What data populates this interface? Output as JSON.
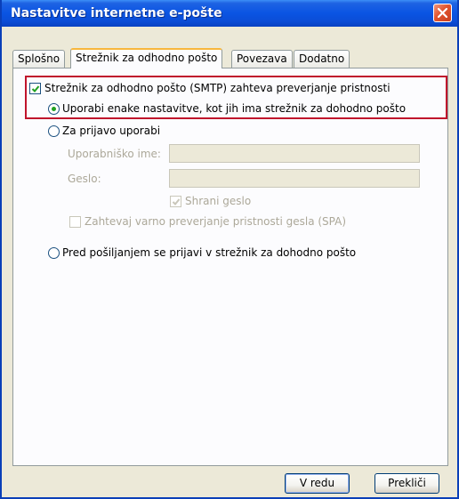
{
  "window": {
    "title": "Nastavitve internetne e-pošte"
  },
  "tabs": [
    {
      "label": "Splošno"
    },
    {
      "label": "Strežnik za odhodno pošto"
    },
    {
      "label": "Povezava"
    },
    {
      "label": "Dodatno"
    }
  ],
  "smtp": {
    "require_auth_label": "Strežnik za odhodno pošto (SMTP) zahteva preverjanje pristnosti",
    "require_auth_checked": true,
    "option_same_label": "Uporabi enake nastavitve, kot jih ima strežnik za dohodno pošto",
    "option_same_selected": true,
    "option_login_label": "Za prijavo uporabi",
    "username_label": "Uporabniško ime:",
    "username_value": "",
    "password_label": "Geslo:",
    "password_value": "",
    "save_password_label": "Shrani geslo",
    "save_password_checked": true,
    "spa_label": "Zahtevaj varno preverjanje pristnosti gesla (SPA)",
    "spa_checked": false,
    "option_before_send_label": "Pred pošiljanjem se prijavi v strežnik za dohodno pošto"
  },
  "buttons": {
    "ok": "V redu",
    "cancel": "Prekliči"
  },
  "colors": {
    "title_bar": "#0A54E3",
    "highlight_border": "#C0142C",
    "close_button": "#E0542E",
    "radio_dot": "#21A121"
  }
}
